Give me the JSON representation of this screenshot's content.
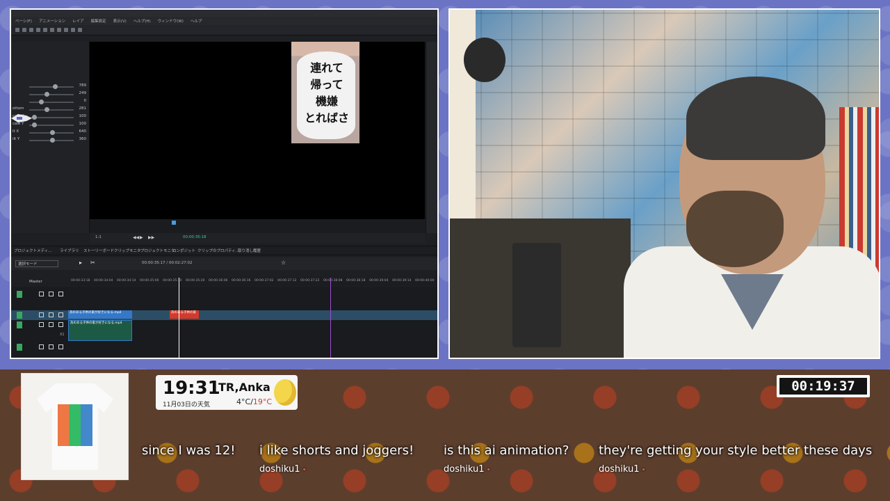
{
  "editor": {
    "menu": [
      "ベーシ(F)",
      "アニメーション",
      "レイア",
      "編集設定",
      "表示(V)",
      "ヘルプ(H)",
      "ウィンドウ(W)",
      "ヘルプ"
    ],
    "properties": [
      {
        "label": "",
        "value": "789"
      },
      {
        "label": "",
        "value": "249"
      },
      {
        "label": "",
        "value": "0"
      },
      {
        "label": "ottom",
        "value": "281"
      },
      {
        "label": "cale X",
        "value": "100"
      },
      {
        "label": "cale Y",
        "value": "100"
      },
      {
        "label": "lt X",
        "value": "640"
      },
      {
        "label": "ilt Y",
        "value": "360"
      }
    ],
    "preview_caption": "連れて\n帰って\n機嫌\nとればさ",
    "preview_timecode": "00:00:35:18",
    "zoom": "1:1",
    "panel_tabs": [
      "プロジェクトメディ...",
      "ライブラリ",
      "ストーリーボード",
      "クリップモニタ",
      "プロジェクトモニタ",
      "コンポジット",
      "クリップのプロパティ...",
      "取り消し履歴"
    ],
    "timeline_mode": "選択モード",
    "timeline_timecode": "00:00:35:17 / 00:02:27:02",
    "ruler_ticks": [
      "00:00:33:18",
      "00:00:34:04",
      "00:00:34:14",
      "00:00:35:00",
      "00:00:35:10",
      "00:00:35:20",
      "00:00:36:06",
      "00:00:36:16",
      "00:00:37:02",
      "00:00:37:12",
      "00:00:37:22",
      "00:00:38:08",
      "00:00:38:18",
      "00:00:39:04",
      "00:00:39:14",
      "00:00:40:00"
    ],
    "master_label": "Master",
    "clips": [
      {
        "text": "為のある子供の家が好きになる.mp4",
        "color": "#3478c8"
      },
      {
        "text": "為のある子供の家",
        "color": "#d43a2a"
      },
      {
        "text": "為のある子供の家が好きになる.mp4",
        "color": "#1d5a46"
      }
    ],
    "track_x1": "X1"
  },
  "overlay": {
    "merch_alt": "t-shirt",
    "weather": {
      "time": "19:31",
      "place": "TR,Anka",
      "date": "11月03日の天気",
      "low": "4°C",
      "sep": "/",
      "high": "19°C"
    },
    "timer": "00:19:37",
    "chat": [
      {
        "message": "since I was 12!",
        "user": ""
      },
      {
        "message": "i like shorts and joggers!",
        "user": "doshiku1"
      },
      {
        "message": "is this ai animation?",
        "user": "doshiku1"
      },
      {
        "message": "they're getting your style better these days",
        "user": "doshiku1"
      }
    ]
  },
  "colors": {
    "frame_bg": "#6b74c4",
    "accent_green": "#2fd2a5",
    "playhead_purple": "#a050d0"
  }
}
